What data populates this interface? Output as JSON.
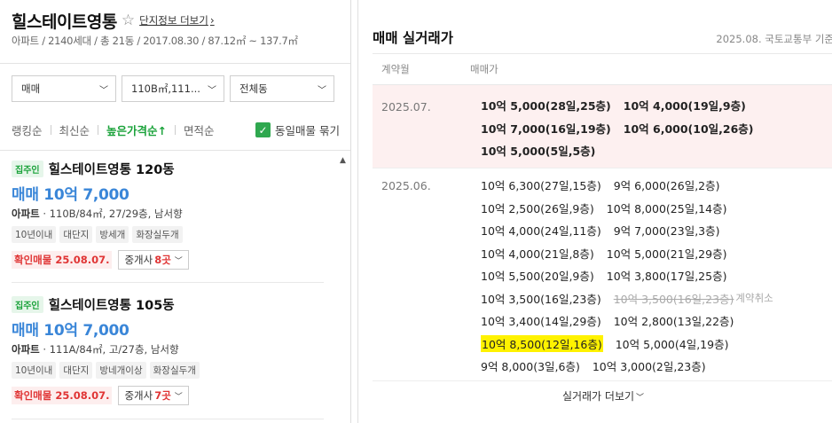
{
  "complex": {
    "name": "힐스테이트영통",
    "info_link": "단지정보 더보기",
    "meta": "아파트 / 2140세대 / 총 21동 / 2017.08.30 / 87.12㎡ ~ 137.7㎡"
  },
  "filters": {
    "trade_type": "매매",
    "area": "110B㎡,111...",
    "building": "전체동"
  },
  "sort": {
    "options": [
      "랭킹순",
      "최신순",
      "높은가격순↑",
      "면적순"
    ],
    "active": "높은가격순↑",
    "group_same_label": "동일매물 묶기",
    "group_same_checked": true
  },
  "listings": [
    {
      "badge": "집주인",
      "title": "힐스테이트영통 120동",
      "price": "매매 10억 7,000",
      "type": "아파트",
      "desc": " · 110B/84㎡, 27/29층, 남서향",
      "tags": [
        "10년이내",
        "대단지",
        "방세개",
        "화장실두개"
      ],
      "confirm": "확인매물 25.08.07.",
      "agent_label": "중개사",
      "agent_count": "8곳"
    },
    {
      "badge": "집주인",
      "title": "힐스테이트영통 105동",
      "price": "매매 10억 7,000",
      "type": "아파트",
      "desc": " · 111A/84㎡, 고/27층, 남서향",
      "tags": [
        "10년이내",
        "대단지",
        "방네개이상",
        "화장실두개"
      ],
      "confirm": "확인매물 25.08.07.",
      "agent_label": "중개사",
      "agent_count": "7곳"
    }
  ],
  "transactions": {
    "title": "매매 실거래가",
    "source": "2025.08. 국토교통부 기준",
    "col_month": "계약월",
    "col_price": "매매가",
    "more_label": "실거래가 더보기",
    "months": [
      {
        "month": "2025.07.",
        "lines": [
          [
            "10억 5,000(28일,25층)",
            "10억 4,000(19일,9층)"
          ],
          [
            "10억 7,000(16일,19층)",
            "10억 6,000(10일,26층)"
          ],
          [
            "10억 5,000(5일,5층)"
          ]
        ]
      },
      {
        "month": "2025.06.",
        "lines": [
          [
            "10억 6,300(27일,15층)",
            "9억 6,000(26일,2층)"
          ],
          [
            "10억 2,500(26일,9층)",
            "10억 8,000(25일,14층)"
          ],
          [
            "10억 4,000(24일,11층)",
            "9억 7,000(23일,3층)"
          ],
          [
            "10억 4,000(21일,8층)",
            "10억 5,000(21일,29층)"
          ],
          [
            "10억 5,500(20일,9층)",
            "10억 3,800(17일,25층)"
          ],
          [
            "10억 3,500(16일,23층)",
            "10억 3,500(16일,23층)"
          ],
          [
            "10억 3,400(14일,29층)",
            "10억 2,800(13일,22층)"
          ],
          [
            "10억 8,500(12일,16층)",
            "10억 5,000(4일,19층)"
          ],
          [
            "9억 8,000(3일,6층)",
            "10억 3,000(2일,23층)"
          ]
        ],
        "canceled_note": "계약취소"
      }
    ]
  },
  "colors": {
    "accent_green": "#1aa23a",
    "price_blue": "#3a86d8",
    "alert_red": "#e03535",
    "highlight_yellow": "#fff200",
    "july_row_bg": "#fdf0f0"
  }
}
